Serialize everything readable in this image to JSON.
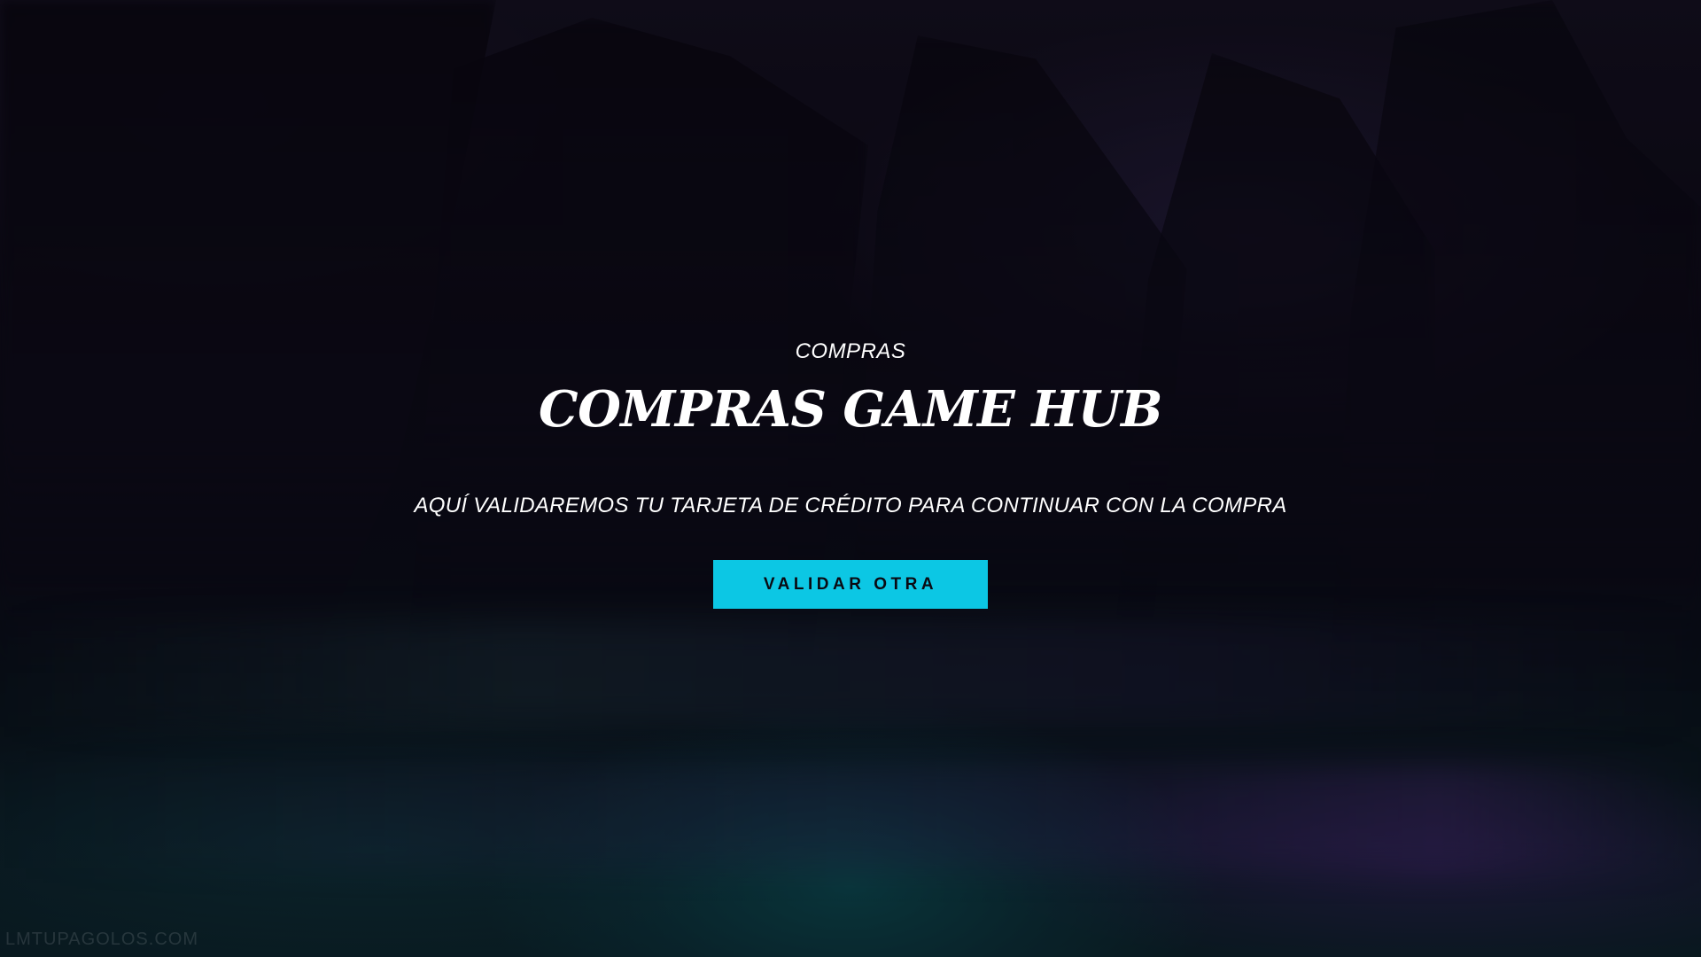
{
  "hero": {
    "eyebrow": "COMPRAS",
    "title": "COMPRAS GAME HUB",
    "subtitle": "AQUÍ VALIDAREMOS TU TARJETA DE CRÉDITO PARA CONTINUAR CON LA COMPRA",
    "cta_label": "VALIDAR OTRA"
  },
  "background": {
    "watermark": "LMTUPAGOLOS.COM"
  },
  "colors": {
    "accent": "#0cc7e4",
    "text": "#ffffff"
  }
}
